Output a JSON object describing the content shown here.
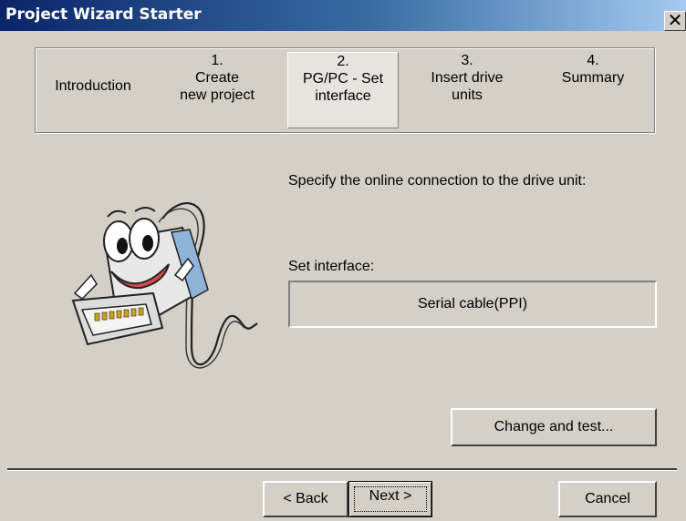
{
  "window": {
    "title": "Project Wizard Starter",
    "close_glyph": "✕"
  },
  "steps": [
    {
      "number": "",
      "label": "Introduction",
      "active": false
    },
    {
      "number": "1.",
      "label": "Create\nnew project",
      "active": false
    },
    {
      "number": "2.",
      "label": "PG/PC - Set\ninterface",
      "active": true
    },
    {
      "number": "3.",
      "label": "Insert drive\nunits",
      "active": false
    },
    {
      "number": "4.",
      "label": "Summary",
      "active": false
    }
  ],
  "content": {
    "prompt": "Specify the online connection to the drive unit:",
    "set_interface_label": "Set interface:",
    "interface_value": "Serial cable(PPI)",
    "change_test_label": "Change and test..."
  },
  "footer": {
    "back_label": "< Back",
    "next_label": "Next >",
    "cancel_label": "Cancel"
  },
  "icons": {
    "mascot": "serial-connector-mascot-icon",
    "close": "close-icon"
  }
}
